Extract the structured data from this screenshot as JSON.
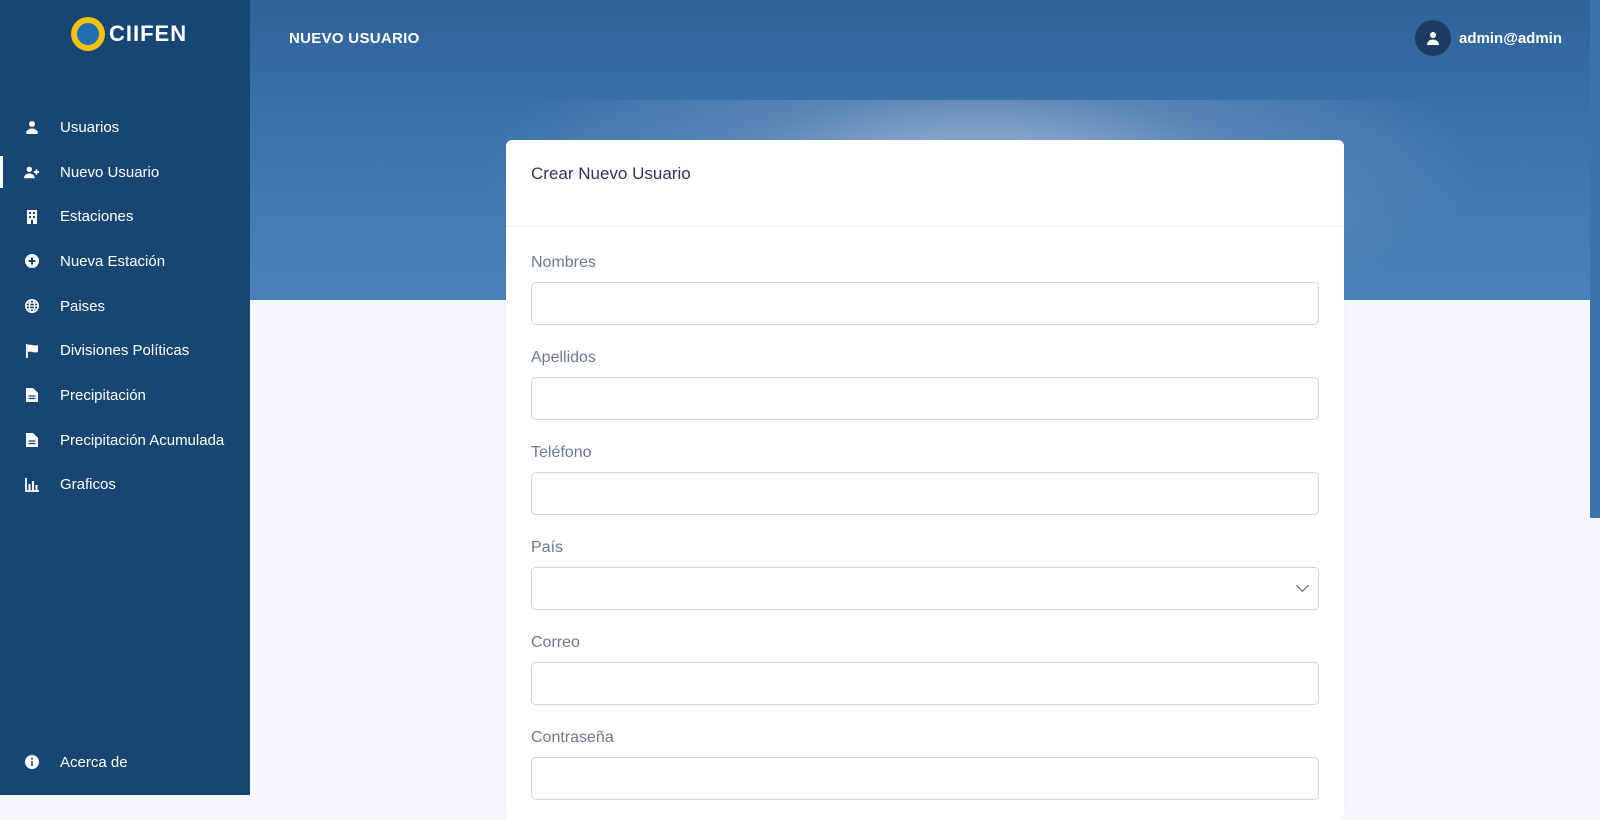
{
  "brand": {
    "name": "CIIFEN"
  },
  "header": {
    "title": "NUEVO USUARIO",
    "user": "admin@admin"
  },
  "sidebar": {
    "items": [
      {
        "label": "Usuarios",
        "icon": "user-icon"
      },
      {
        "label": "Nuevo Usuario",
        "icon": "user-plus-icon",
        "active": true
      },
      {
        "label": "Estaciones",
        "icon": "building-icon"
      },
      {
        "label": "Nueva Estación",
        "icon": "plus-circle-icon"
      },
      {
        "label": "Paises",
        "icon": "globe-icon"
      },
      {
        "label": "Divisiones Políticas",
        "icon": "flag-icon"
      },
      {
        "label": "Precipitación",
        "icon": "file-icon"
      },
      {
        "label": "Precipitación Acumulada",
        "icon": "file-icon"
      },
      {
        "label": "Graficos",
        "icon": "chart-bar-icon"
      }
    ],
    "bottom": {
      "label": "Acerca de",
      "icon": "info-icon"
    }
  },
  "form": {
    "title": "Crear Nuevo Usuario",
    "fields": {
      "nombres": {
        "label": "Nombres",
        "value": ""
      },
      "apellidos": {
        "label": "Apellidos",
        "value": ""
      },
      "telefono": {
        "label": "Teléfono",
        "value": ""
      },
      "pais": {
        "label": "País",
        "value": ""
      },
      "correo": {
        "label": "Correo",
        "value": ""
      },
      "contrasena": {
        "label": "Contraseña",
        "value": ""
      }
    }
  },
  "colors": {
    "sidebar": "#174673",
    "header": "#3b74ad",
    "accent": "#f4c20d"
  }
}
